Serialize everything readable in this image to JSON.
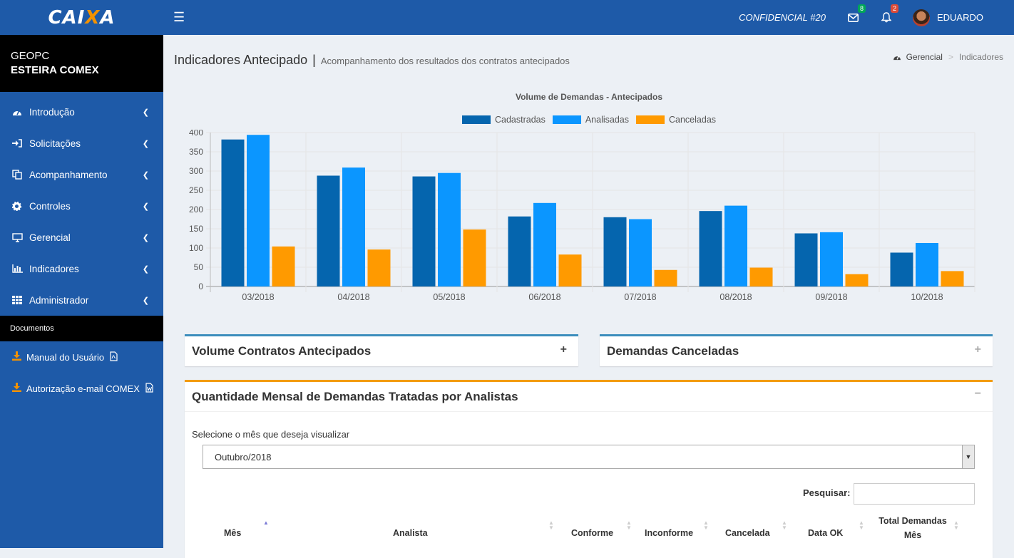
{
  "header": {
    "logo_text_1": "CAI",
    "logo_text_2": "X",
    "logo_text_3": "A",
    "confidencial": "CONFIDENCIAL #20",
    "mail_badge": "8",
    "bell_badge": "2",
    "user_name": "EDUARDO",
    "colors": {
      "bar": "#1e5aa8",
      "mail_badge": "#00a65a",
      "bell_badge": "#dd4b39"
    }
  },
  "sidebar": {
    "org": "GEOPC",
    "system": "ESTEIRA COMEX",
    "items": [
      {
        "label": "Introdução",
        "icon": "dashboard-icon"
      },
      {
        "label": "Solicitações",
        "icon": "sign-in-icon"
      },
      {
        "label": "Acompanhamento",
        "icon": "copy-icon"
      },
      {
        "label": "Controles",
        "icon": "gear-icon"
      },
      {
        "label": "Gerencial",
        "icon": "desktop-icon"
      },
      {
        "label": "Indicadores",
        "icon": "bar-chart-icon"
      },
      {
        "label": "Administrador",
        "icon": "grid-icon"
      }
    ],
    "section_label": "Documentos",
    "documents": [
      {
        "label": "Manual do Usuário",
        "file_icon": "pdf-file-icon"
      },
      {
        "label": "Autorização e-mail COMEX",
        "file_icon": "word-file-icon"
      }
    ]
  },
  "page": {
    "title": "Indicadores Antecipado",
    "separator": "|",
    "subtitle": "Acompanhamento dos resultados dos contratos antecipados",
    "breadcrumb": {
      "home": "Gerencial",
      "sep": ">",
      "current": "Indicadores"
    }
  },
  "chart_data": {
    "type": "bar",
    "title": "Volume de Demandas - Antecipados",
    "categories": [
      "03/2018",
      "04/2018",
      "05/2018",
      "06/2018",
      "07/2018",
      "08/2018",
      "09/2018",
      "10/2018"
    ],
    "series": [
      {
        "name": "Cadastradas",
        "color": "#0565ae",
        "values": [
          382,
          288,
          286,
          182,
          180,
          196,
          138,
          88
        ]
      },
      {
        "name": "Analisadas",
        "color": "#0b96ff",
        "values": [
          394,
          309,
          295,
          217,
          175,
          210,
          141,
          113
        ]
      },
      {
        "name": "Canceladas",
        "color": "#ff9a00",
        "values": [
          104,
          96,
          148,
          83,
          43,
          49,
          32,
          40
        ]
      }
    ],
    "yticks": [
      0,
      50,
      100,
      150,
      200,
      250,
      300,
      350,
      400
    ],
    "ylim": [
      0,
      400
    ],
    "grid": true,
    "legend_position": "top"
  },
  "boxes": {
    "volume": {
      "title": "Volume Contratos Antecipados",
      "tool": "+"
    },
    "canceladas": {
      "title": "Demandas Canceladas",
      "tool": "+"
    },
    "mensal": {
      "title": "Quantidade Mensal de Demandas Tratadas por Analistas",
      "tool": "−",
      "select_label": "Selecione o mês que deseja visualizar",
      "select_value": "Outubro/2018",
      "search_label": "Pesquisar:",
      "search_value": "",
      "columns": [
        "Mês",
        "Analista",
        "Conforme",
        "Inconforme",
        "Cancelada",
        "Data OK",
        "Total Demandas Mês"
      ]
    }
  }
}
